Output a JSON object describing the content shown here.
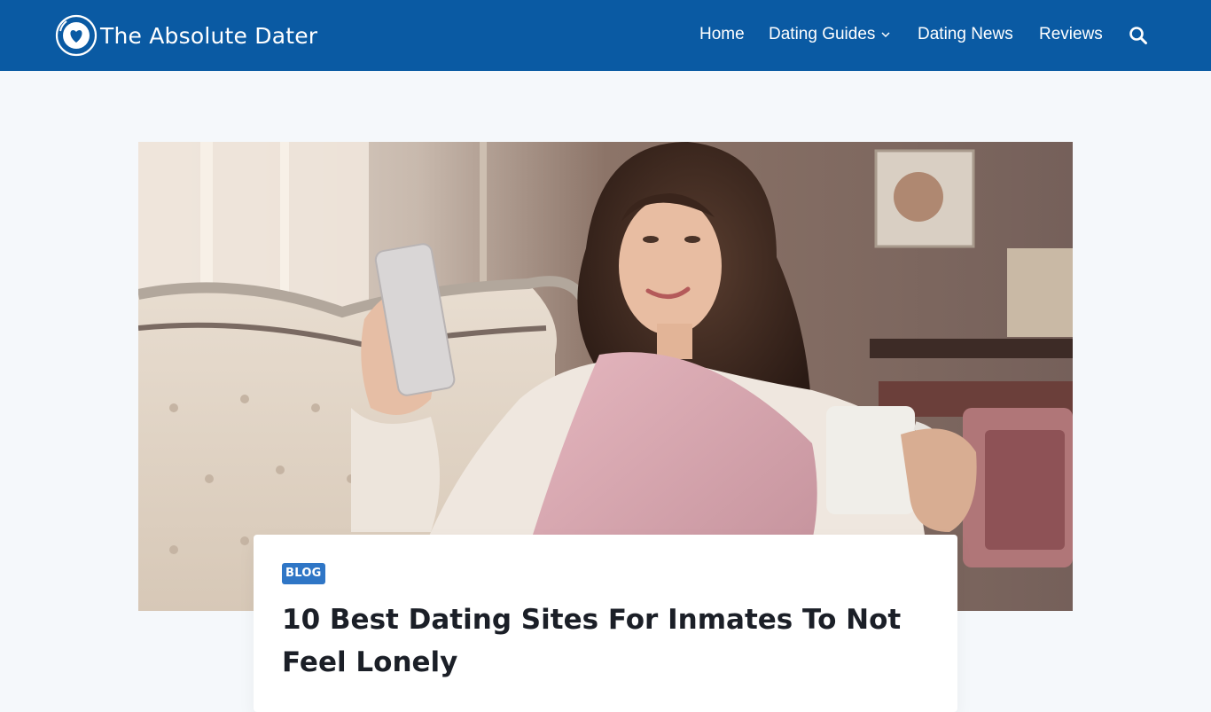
{
  "site": {
    "name": "The Absolute Dater",
    "brand_color": "#0a5aa3",
    "page_bg": "#f5f8fb",
    "logo_icon": "heart-circle-icon"
  },
  "nav": {
    "home": "Home",
    "guides": "Dating Guides",
    "news": "Dating News",
    "reviews": "Reviews",
    "search_icon": "search-icon"
  },
  "hero": {
    "image": "woman-with-phone-and-mug-photo"
  },
  "post": {
    "category": "BLOG",
    "category_color": "#2f76c6",
    "title": "10 Best Dating Sites For Inmates To Not Feel Lonely"
  }
}
